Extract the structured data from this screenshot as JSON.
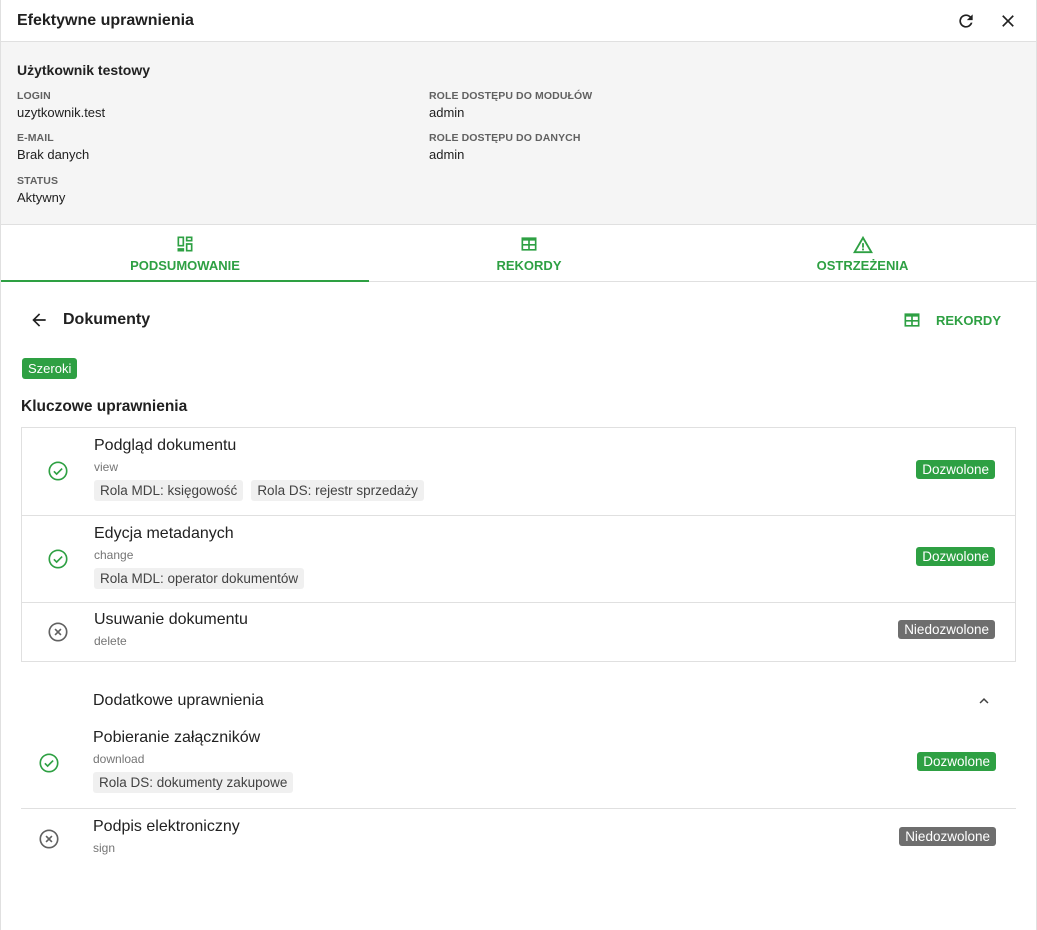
{
  "header": {
    "title": "Efektywne uprawnienia",
    "refresh_icon": "refresh-icon",
    "close_icon": "close-icon"
  },
  "user": {
    "name": "Użytkownik testowy",
    "fields": {
      "login": {
        "label": "LOGIN",
        "value": "uzytkownik.test"
      },
      "email": {
        "label": "E-MAIL",
        "value": "Brak danych"
      },
      "status": {
        "label": "STATUS",
        "value": "Aktywny"
      },
      "module_roles": {
        "label": "ROLE DOSTĘPU DO MODUŁÓW",
        "value": "admin"
      },
      "data_roles": {
        "label": "ROLE DOSTĘPU DO DANYCH",
        "value": "admin"
      }
    }
  },
  "tabs": [
    {
      "label": "PODSUMOWANIE",
      "icon": "dashboard-icon",
      "active": true
    },
    {
      "label": "REKORDY",
      "icon": "table-icon",
      "active": false
    },
    {
      "label": "OSTRZEŻENIA",
      "icon": "warning-icon",
      "active": false
    }
  ],
  "module": {
    "title": "Dokumenty",
    "records_button": "REKORDY",
    "scope_badge": "Szeroki"
  },
  "key_permissions": {
    "title": "Kluczowe uprawnienia",
    "items": [
      {
        "name": "Podgląd dokumentu",
        "code": "view",
        "status": "Dozwolone",
        "allowed": true,
        "chips": [
          "Rola MDL: księgowość",
          "Rola DS: rejestr sprzedaży"
        ]
      },
      {
        "name": "Edycja metadanych",
        "code": "change",
        "status": "Dozwolone",
        "allowed": true,
        "chips": [
          "Rola MDL: operator dokumentów"
        ]
      },
      {
        "name": "Usuwanie dokumentu",
        "code": "delete",
        "status": "Niedozwolone",
        "allowed": false,
        "chips": []
      }
    ]
  },
  "additional_permissions": {
    "title": "Dodatkowe uprawnienia",
    "items": [
      {
        "name": "Pobieranie załączników",
        "code": "download",
        "status": "Dozwolone",
        "allowed": true,
        "chips": [
          "Rola DS: dokumenty zakupowe"
        ]
      },
      {
        "name": "Podpis elektroniczny",
        "code": "sign",
        "status": "Niedozwolone",
        "allowed": false,
        "chips": []
      }
    ]
  },
  "colors": {
    "accent": "#2ea043",
    "denied": "#6e6e6e",
    "panel_bg": "#f5f5f5"
  }
}
